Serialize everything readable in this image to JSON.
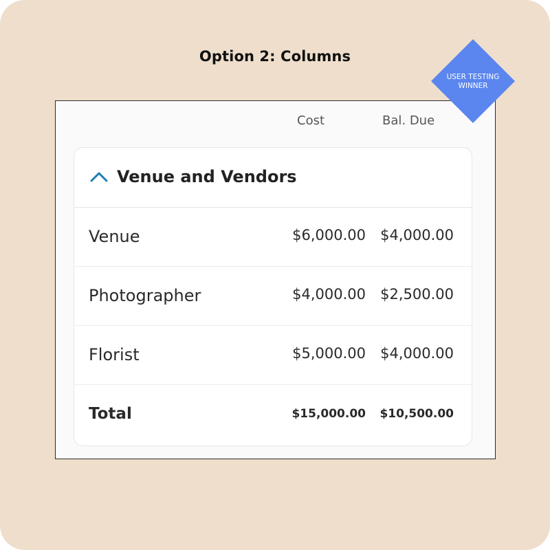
{
  "heading": "Option 2: Columns",
  "badge": {
    "line1": "USER TESTING",
    "line2": "WINNER",
    "color": "#5b86ef"
  },
  "columns": {
    "cost": "Cost",
    "balance_due": "Bal. Due"
  },
  "section": {
    "title": "Venue and Vendors",
    "expanded": true,
    "icon": "chevron-up-icon",
    "accent_color": "#1b7fb3",
    "rows": [
      {
        "label": "Venue",
        "cost": "$6,000.00",
        "balance_due": "$4,000.00"
      },
      {
        "label": "Photographer",
        "cost": "$4,000.00",
        "balance_due": "$2,500.00"
      },
      {
        "label": "Florist",
        "cost": "$5,000.00",
        "balance_due": "$4,000.00"
      }
    ],
    "total": {
      "label": "Total",
      "cost": "$15,000.00",
      "balance_due": "$10,500.00"
    }
  },
  "colors": {
    "background": "#eedecb",
    "panel": "#fafafa",
    "card": "#ffffff"
  }
}
